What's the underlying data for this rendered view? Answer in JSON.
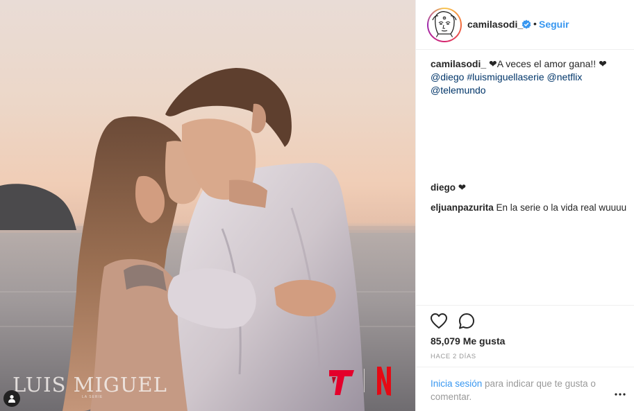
{
  "post": {
    "username": "camilasodi_",
    "follow_label": "Seguir",
    "dot": "•",
    "caption": {
      "username": "camilasodi_",
      "heart_1": "❤",
      "text": "A veces el amor gana!!",
      "heart_2": "❤",
      "mention_1": "@diego",
      "hashtag": "#luismiguellaserie",
      "mention_2": "@netflix",
      "mention_3": "@telemundo"
    },
    "comments": [
      {
        "username": "diego",
        "text": "❤"
      },
      {
        "username": "eljuanpazurita",
        "text": "En la serie o la vida real wuuuu"
      }
    ],
    "likes_text": "85,079 Me gusta",
    "timestamp": "HACE 2 DÍAS",
    "login_link": "Inicia sesión",
    "login_rest": " para indicar que te gusta o comentar."
  },
  "photo": {
    "brand_left": "LUIS MIGUEL",
    "brand_left_sub": "LA SERIE"
  },
  "icons": {
    "verified": "verified-badge-icon",
    "heart": "heart-outline-icon",
    "comment": "comment-bubble-icon",
    "more": "more-dots-icon",
    "user_tag": "user-tag-icon"
  },
  "colors": {
    "link_blue": "#3897f0",
    "mention_navy": "#003569",
    "telemundo_red": "#e4002b",
    "netflix_red": "#e50914"
  }
}
